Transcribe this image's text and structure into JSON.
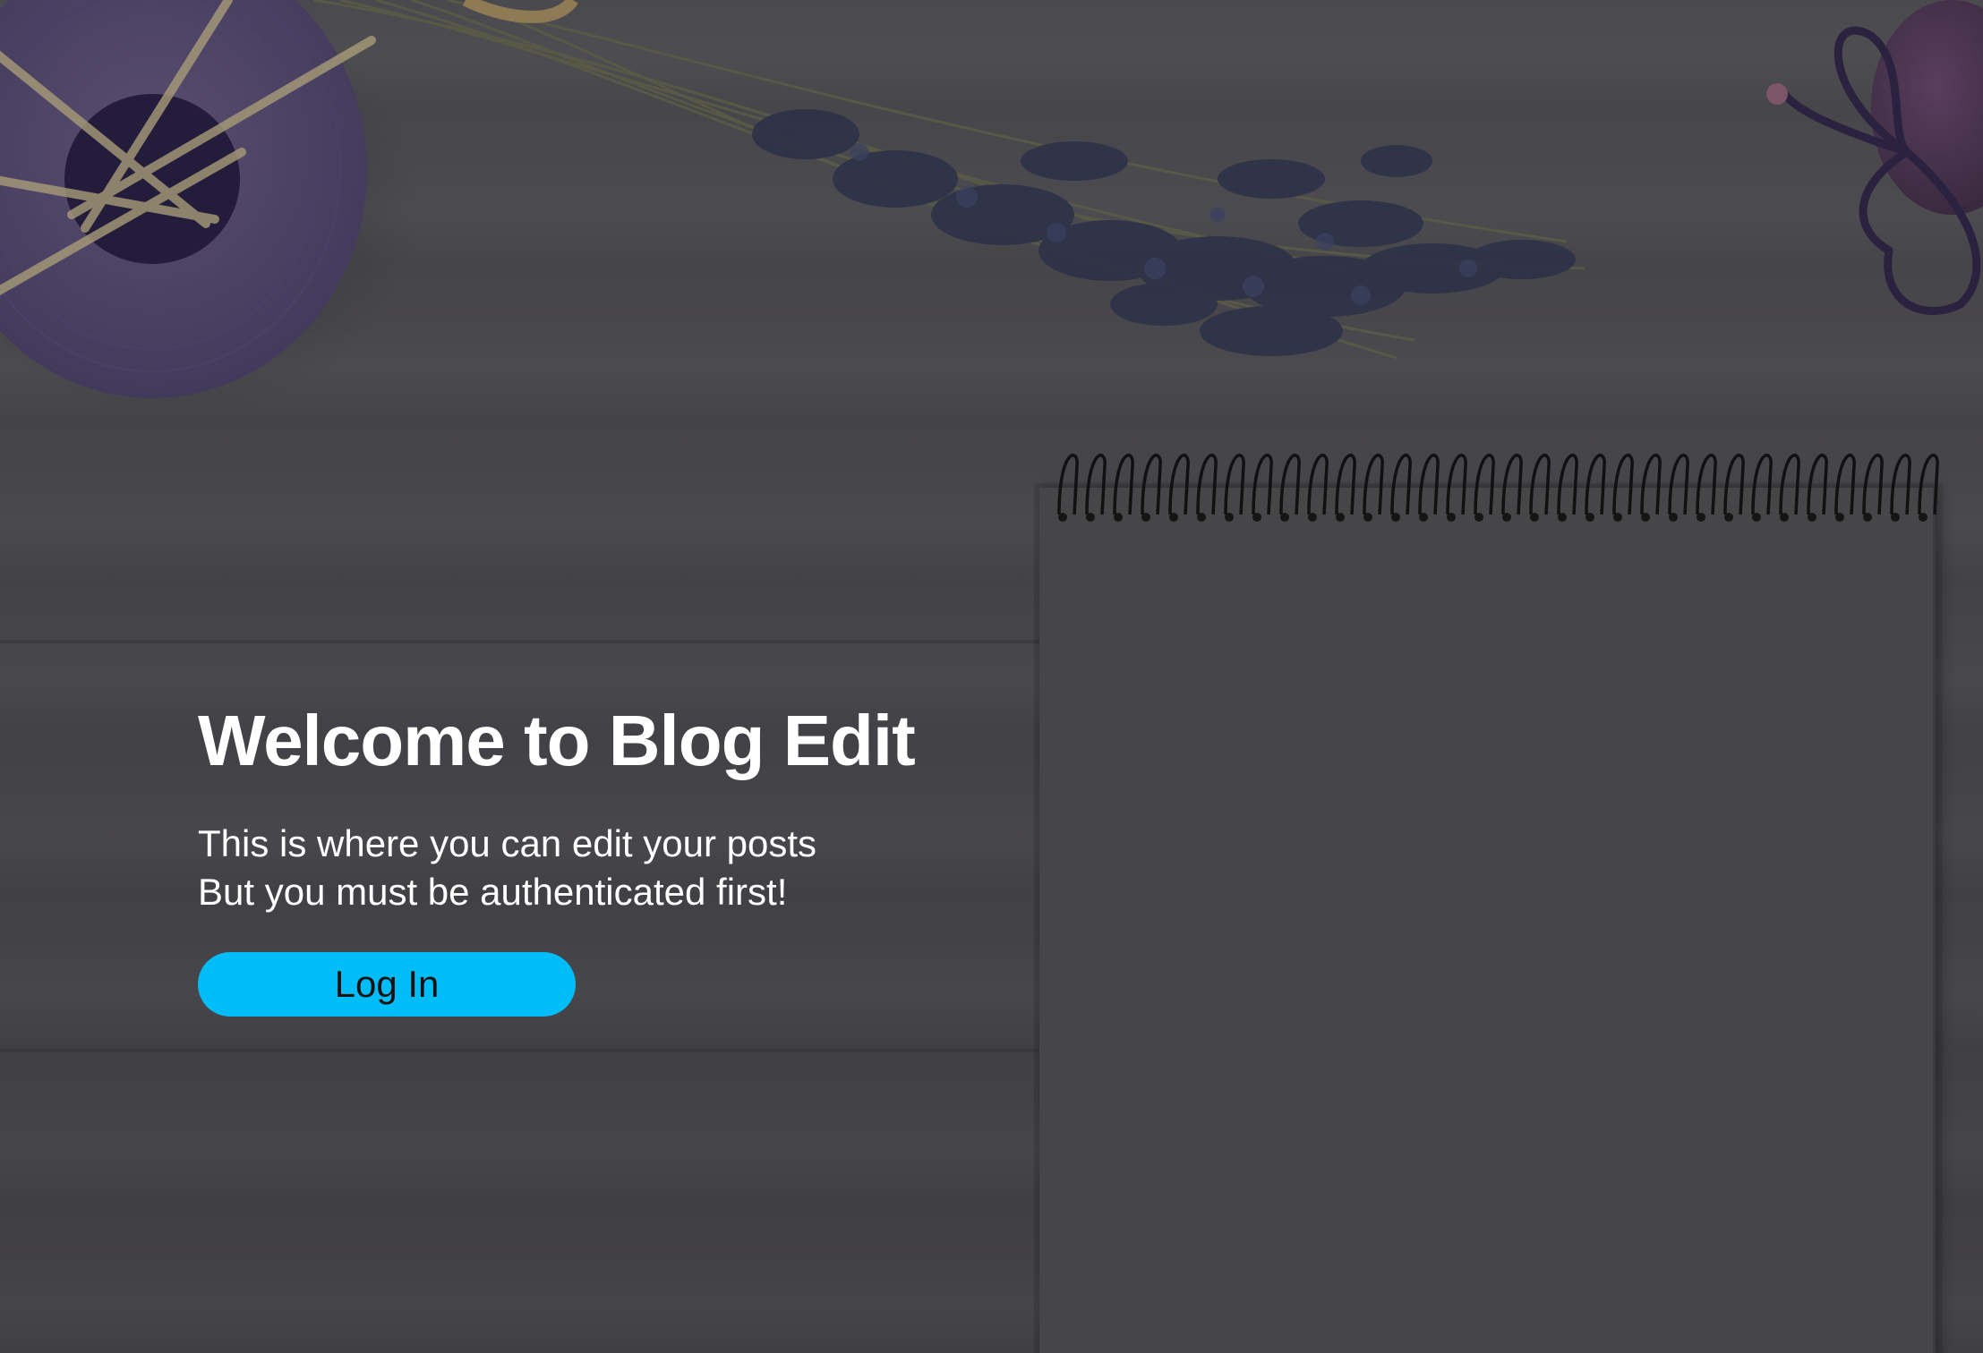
{
  "hero": {
    "title": "Welcome to Blog Edit",
    "line1": "This is where you can edit your posts",
    "line2": "But you must be authenticated first!",
    "login_label": "Log In"
  },
  "colors": {
    "background": "#47464a",
    "button": "#00bdf7",
    "title_text": "#ffffff",
    "button_text": "#111111"
  },
  "icons": [
    "reed-diffuser-vase",
    "lavender-bouquet",
    "twine-bow",
    "spiral-notepad"
  ]
}
